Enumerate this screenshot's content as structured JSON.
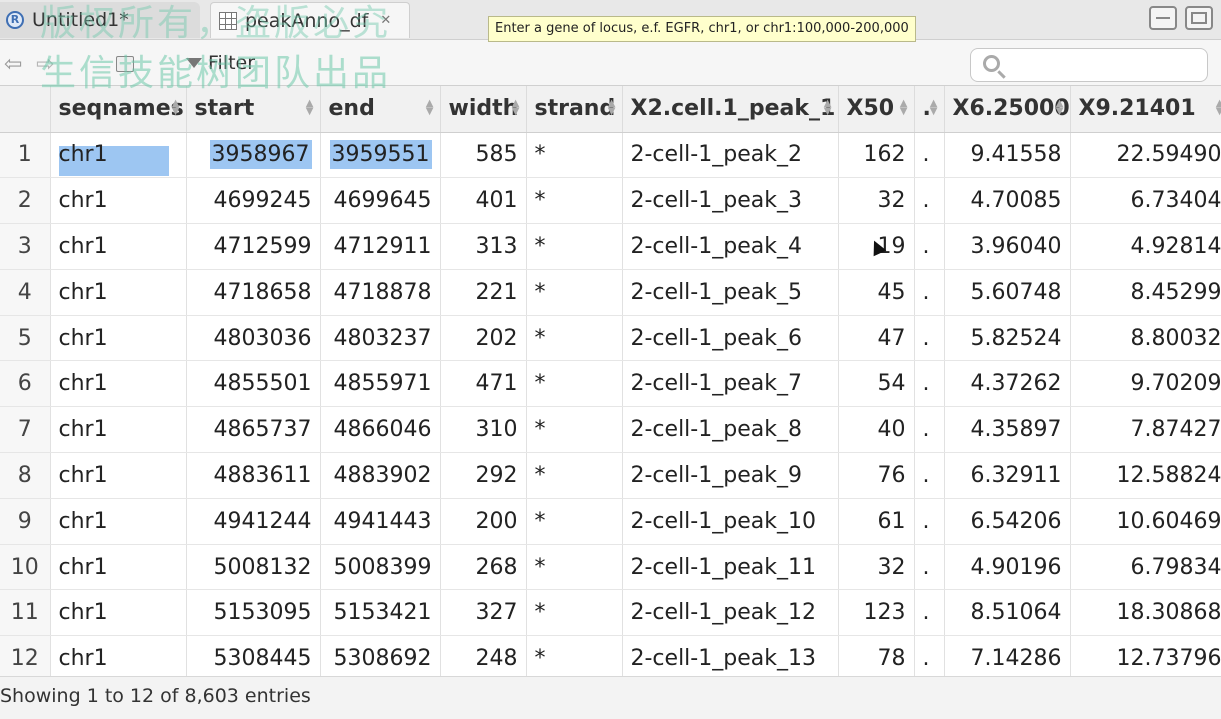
{
  "tabs": [
    {
      "label": "Untitled1*",
      "icon": "r-script-icon"
    },
    {
      "label": "peakAnno_df",
      "icon": "data-grid-icon",
      "close": "✕"
    }
  ],
  "tooltip": "Enter a gene of locus, e.f. EGFR,   chr1,   or chr1:100,000-200,000",
  "toolbar": {
    "filter_label": "Filter",
    "search_placeholder": ""
  },
  "watermark": {
    "line1": "版权所有，盗版必究",
    "line2": "生信技能树团队出品"
  },
  "table": {
    "columns": [
      "",
      "seqnames",
      "start",
      "end",
      "width",
      "strand",
      "X2.cell.1_peak_1",
      "X50",
      ".",
      "X6.25000",
      "X9.21401"
    ],
    "rows": [
      [
        "1",
        "chr1",
        "3958967",
        "3959551",
        "585",
        "*",
        "2-cell-1_peak_2",
        "162",
        ".",
        "9.41558",
        "22.59490"
      ],
      [
        "2",
        "chr1",
        "4699245",
        "4699645",
        "401",
        "*",
        "2-cell-1_peak_3",
        "32",
        ".",
        "4.70085",
        "6.73404"
      ],
      [
        "3",
        "chr1",
        "4712599",
        "4712911",
        "313",
        "*",
        "2-cell-1_peak_4",
        "19",
        ".",
        "3.96040",
        "4.92814"
      ],
      [
        "4",
        "chr1",
        "4718658",
        "4718878",
        "221",
        "*",
        "2-cell-1_peak_5",
        "45",
        ".",
        "5.60748",
        "8.45299"
      ],
      [
        "5",
        "chr1",
        "4803036",
        "4803237",
        "202",
        "*",
        "2-cell-1_peak_6",
        "47",
        ".",
        "5.82524",
        "8.80032"
      ],
      [
        "6",
        "chr1",
        "4855501",
        "4855971",
        "471",
        "*",
        "2-cell-1_peak_7",
        "54",
        ".",
        "4.37262",
        "9.70209"
      ],
      [
        "7",
        "chr1",
        "4865737",
        "4866046",
        "310",
        "*",
        "2-cell-1_peak_8",
        "40",
        ".",
        "4.35897",
        "7.87427"
      ],
      [
        "8",
        "chr1",
        "4883611",
        "4883902",
        "292",
        "*",
        "2-cell-1_peak_9",
        "76",
        ".",
        "6.32911",
        "12.58824"
      ],
      [
        "9",
        "chr1",
        "4941244",
        "4941443",
        "200",
        "*",
        "2-cell-1_peak_10",
        "61",
        ".",
        "6.54206",
        "10.60469"
      ],
      [
        "10",
        "chr1",
        "5008132",
        "5008399",
        "268",
        "*",
        "2-cell-1_peak_11",
        "32",
        ".",
        "4.90196",
        "6.79834"
      ],
      [
        "11",
        "chr1",
        "5153095",
        "5153421",
        "327",
        "*",
        "2-cell-1_peak_12",
        "123",
        ".",
        "8.51064",
        "18.30868"
      ],
      [
        "12",
        "chr1",
        "5308445",
        "5308692",
        "248",
        "*",
        "2-cell-1_peak_13",
        "78",
        ".",
        "7.14286",
        "12.73796"
      ]
    ]
  },
  "status": "Showing 1 to 12 of 8,603 entries",
  "colors": {
    "selection": "#9dc6f2",
    "tooltip_bg": "#ffffcc",
    "watermark": "#6ec8aa"
  }
}
